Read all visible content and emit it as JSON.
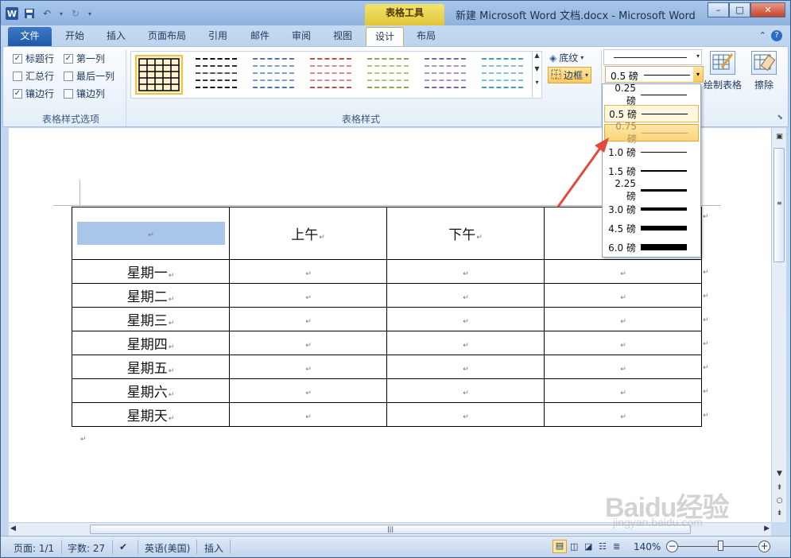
{
  "titlebar": {
    "contextual_group": "表格工具",
    "title": "新建 Microsoft Word 文档.docx - Microsoft Word",
    "min": "–",
    "max": "□",
    "close": "✕"
  },
  "tabs": [
    {
      "label": "文件"
    },
    {
      "label": "开始"
    },
    {
      "label": "插入"
    },
    {
      "label": "页面布局"
    },
    {
      "label": "引用"
    },
    {
      "label": "邮件"
    },
    {
      "label": "审阅"
    },
    {
      "label": "视图"
    },
    {
      "label": "设计"
    },
    {
      "label": "布局"
    }
  ],
  "ribbon": {
    "style_options": {
      "group_label": "表格样式选项",
      "items": [
        {
          "label": "标题行",
          "checked": true
        },
        {
          "label": "第一列",
          "checked": true
        },
        {
          "label": "汇总行",
          "checked": false
        },
        {
          "label": "最后一列",
          "checked": false
        },
        {
          "label": "镶边行",
          "checked": true
        },
        {
          "label": "镶边列",
          "checked": false
        }
      ]
    },
    "styles": {
      "group_label": "表格样式",
      "shading": "底纹",
      "borders": "边框"
    },
    "line_weight": "0.5 磅",
    "draw_table": "绘制表格",
    "eraser": "擦除"
  },
  "dropdown": {
    "items": [
      {
        "label": "0.25 磅",
        "weight": 0.25
      },
      {
        "label": "0.5 磅",
        "weight": 0.5
      },
      {
        "label": "0.75 磅",
        "weight": 0.75
      },
      {
        "label": "1.0 磅",
        "weight": 1.0
      },
      {
        "label": "1.5 磅",
        "weight": 1.5
      },
      {
        "label": "2.25 磅",
        "weight": 2.25
      },
      {
        "label": "3.0 磅",
        "weight": 3.0
      },
      {
        "label": "4.5 磅",
        "weight": 4.5
      },
      {
        "label": "6.0 磅",
        "weight": 6.0
      }
    ],
    "selected_index": 1,
    "hovered_index": 2
  },
  "document": {
    "header": [
      "",
      "上午",
      "下午",
      ""
    ],
    "rows": [
      "星期一",
      "星期二",
      "星期三",
      "星期四",
      "星期五",
      "星期六",
      "星期天"
    ],
    "para_mark": "↵"
  },
  "statusbar": {
    "page": "页面: 1/1",
    "words": "字数: 27",
    "language": "英语(美国)",
    "mode": "插入",
    "zoom": "140%",
    "zoom_out": "−",
    "zoom_in": "+"
  },
  "watermark": {
    "main": "Baidu经验",
    "sub": "jingyan.baidu.com"
  },
  "colors": {
    "accent": "#2b579a",
    "selection": "#a9c6ea",
    "highlight": "#fbd57b",
    "arrow": "#e5483f"
  }
}
